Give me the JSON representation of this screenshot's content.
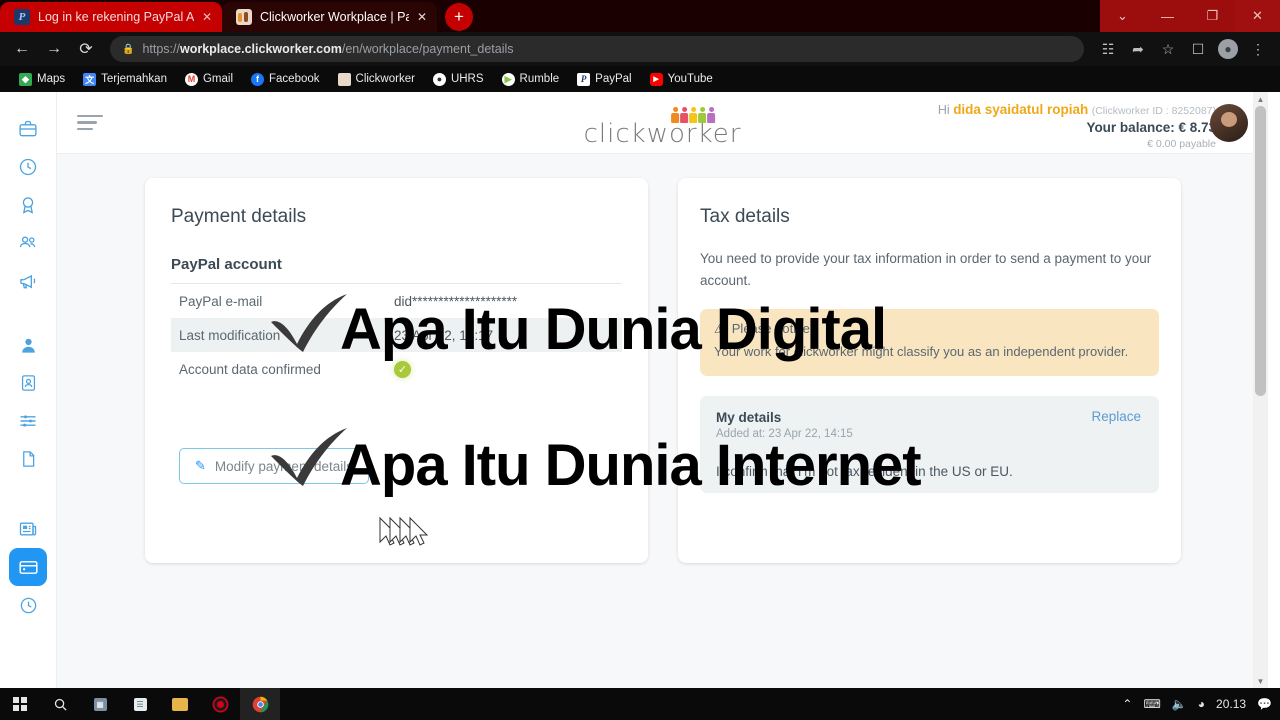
{
  "browser": {
    "tabs": [
      {
        "title": "Log in ke rekening PayPal Anda",
        "favicon": "paypal-icon",
        "active": false,
        "close": "✕"
      },
      {
        "title": "Clickworker Workplace | Paymen",
        "favicon": "clickworker-icon",
        "active": true,
        "close": "✕"
      }
    ],
    "new_tab_label": "+",
    "window_controls": {
      "chevron": "⌄",
      "minimize": "—",
      "restore": "❐",
      "close": "✕"
    },
    "nav": {
      "back": "←",
      "forward": "→",
      "reload": "⟳",
      "lock": "🔒"
    },
    "url": {
      "scheme": "https://",
      "host": "workplace.clickworker.com",
      "path": "/en/workplace/payment_details"
    },
    "toolbar_icons": [
      "translate-icon",
      "share-icon",
      "star-icon",
      "sidepanel-icon",
      "profile-icon",
      "menu-icon"
    ],
    "bookmarks": [
      {
        "label": "Maps",
        "icon": "maps-icon",
        "glyph": "◆"
      },
      {
        "label": "Terjemahkan",
        "icon": "translate-icon",
        "glyph": "文"
      },
      {
        "label": "Gmail",
        "icon": "gmail-icon",
        "glyph": "M"
      },
      {
        "label": "Facebook",
        "icon": "facebook-icon",
        "glyph": "f"
      },
      {
        "label": "Clickworker",
        "icon": "clickworker-icon",
        "glyph": ""
      },
      {
        "label": "UHRS",
        "icon": "uhrs-icon",
        "glyph": "●"
      },
      {
        "label": "Rumble",
        "icon": "rumble-icon",
        "glyph": "▶"
      },
      {
        "label": "PayPal",
        "icon": "paypal-icon",
        "glyph": "P"
      },
      {
        "label": "YouTube",
        "icon": "youtube-icon",
        "glyph": "▶"
      }
    ]
  },
  "sidebar": {
    "items": [
      {
        "name": "jobs",
        "icon": "briefcase-icon",
        "glyph": "💼",
        "active": false
      },
      {
        "name": "history",
        "icon": "clock-history-icon",
        "glyph": "🕐",
        "active": false
      },
      {
        "name": "achievements",
        "icon": "award-icon",
        "glyph": "🏅",
        "active": false
      },
      {
        "name": "community",
        "icon": "people-icon",
        "glyph": "👥",
        "active": false
      },
      {
        "name": "news-feed",
        "icon": "megaphone-icon",
        "glyph": "📣",
        "active": false
      },
      {
        "name": "profile",
        "icon": "person-icon",
        "glyph": "👤",
        "active": false
      },
      {
        "name": "identity",
        "icon": "id-card-icon",
        "glyph": "🪪",
        "active": false
      },
      {
        "name": "settings",
        "icon": "sliders-icon",
        "glyph": "⚙",
        "active": false
      },
      {
        "name": "documents",
        "icon": "document-icon",
        "glyph": "📄",
        "active": false
      },
      {
        "name": "newsletter",
        "icon": "news-icon",
        "glyph": "📰",
        "active": false
      },
      {
        "name": "payment",
        "icon": "wallet-icon",
        "glyph": "💳",
        "active": true
      },
      {
        "name": "recent",
        "icon": "clock-icon",
        "glyph": "🕐",
        "active": false
      }
    ]
  },
  "header": {
    "menu_label": "hamburger-menu",
    "logo_text": "clickworker",
    "greeting_prefix": "Hi ",
    "user_name": "dida syaidatul ropiah",
    "user_id": "(Clickworker ID : 8252087)",
    "balance": "Your balance: € 8.73",
    "payable": "€ 0.00 payable",
    "chevron": "⌄"
  },
  "payment_card": {
    "title": "Payment details",
    "subhead": "PayPal account",
    "rows": [
      {
        "key": "PayPal e-mail",
        "value": "did********************"
      },
      {
        "key": "Last modification",
        "value": "23 Apr 22, 14:17"
      },
      {
        "key": "Account data confirmed",
        "value": "✓"
      }
    ],
    "button_label": "Modify payment details",
    "button_icon": "pencil-icon"
  },
  "tax_card": {
    "title": "Tax details",
    "intro": "You need to provide your tax information in order to send a payment to your account.",
    "notice_title": "Please notice",
    "notice_icon": "warning-icon",
    "notice_body": "Your work for clickworker might classify you as an independent provider.",
    "details_title": "My details",
    "details_added": "Added at: 23 Apr 22, 14:15",
    "details_confirm": "I confirm that I'm not tax resident in the US or EU.",
    "replace_label": "Replace"
  },
  "overlay": {
    "line1": "Apa Itu Dunia Digital",
    "line2": "Apa Itu Dunia Internet",
    "check_icon": "checkmark-icon",
    "cursor_icon": "cursor-arrow-icon"
  },
  "taskbar": {
    "items": [
      {
        "name": "start",
        "icon": "windows-logo-icon"
      },
      {
        "name": "search",
        "icon": "search-icon",
        "glyph": "⌕"
      },
      {
        "name": "calculator",
        "icon": "calculator-icon",
        "glyph": "▤"
      },
      {
        "name": "notepad",
        "icon": "notepad-icon",
        "glyph": "▤"
      },
      {
        "name": "file-explorer",
        "icon": "folder-icon",
        "glyph": "▬"
      },
      {
        "name": "screen-recorder",
        "icon": "record-icon",
        "glyph": "⬤"
      },
      {
        "name": "chrome",
        "icon": "chrome-icon",
        "glyph": "◍"
      }
    ],
    "tray": {
      "expand": "⌃",
      "keyboard": "⌨",
      "volume": "🔊",
      "wifi": "📶",
      "time": "20.13",
      "notifications": "🗨"
    }
  },
  "colors": {
    "accent": "#2196f3",
    "brand_gold": "#f0a818",
    "notice_bg": "#f9e6c0",
    "success": "#a8c93a",
    "tab_red": "#c40000"
  }
}
